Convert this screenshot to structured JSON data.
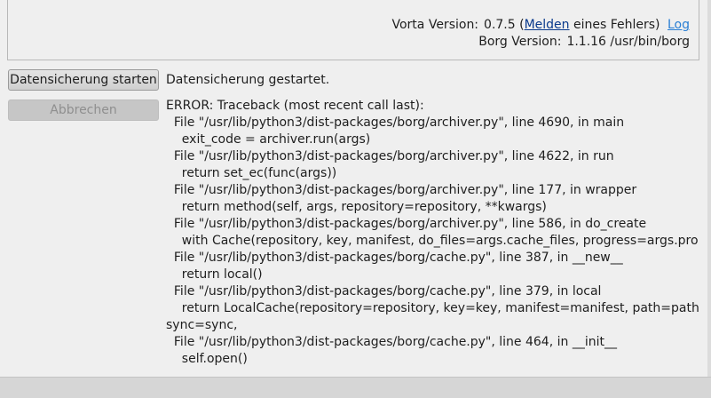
{
  "version_info": {
    "vorta_label": "Vorta Version:",
    "vorta_version": "0.7.5",
    "paren_open": "(",
    "report_link": "Melden",
    "report_suffix": " eines Fehlers)",
    "log_link": "Log",
    "borg_label": "Borg Version:",
    "borg_version": "1.1.16",
    "borg_path": "/usr/bin/borg"
  },
  "actions": {
    "start_backup": "Datensicherung starten",
    "cancel": "Abbrechen"
  },
  "status": {
    "message": "Datensicherung gestartet."
  },
  "log_lines": [
    "ERROR: Traceback (most recent call last):",
    "  File \"/usr/lib/python3/dist-packages/borg/archiver.py\", line 4690, in main",
    "    exit_code = archiver.run(args)",
    "  File \"/usr/lib/python3/dist-packages/borg/archiver.py\", line 4622, in run",
    "    return set_ec(func(args))",
    "  File \"/usr/lib/python3/dist-packages/borg/archiver.py\", line 177, in wrapper",
    "    return method(self, args, repository=repository, **kwargs)",
    "  File \"/usr/lib/python3/dist-packages/borg/archiver.py\", line 586, in do_create",
    "    with Cache(repository, key, manifest, do_files=args.cache_files, progress=args.progress,",
    "  File \"/usr/lib/python3/dist-packages/borg/cache.py\", line 387, in __new__",
    "    return local()",
    "  File \"/usr/lib/python3/dist-packages/borg/cache.py\", line 379, in local",
    "    return LocalCache(repository=repository, key=key, manifest=manifest, path=path,",
    "sync=sync,",
    "  File \"/usr/lib/python3/dist-packages/borg/cache.py\", line 464, in __init__",
    "    self.open()"
  ]
}
